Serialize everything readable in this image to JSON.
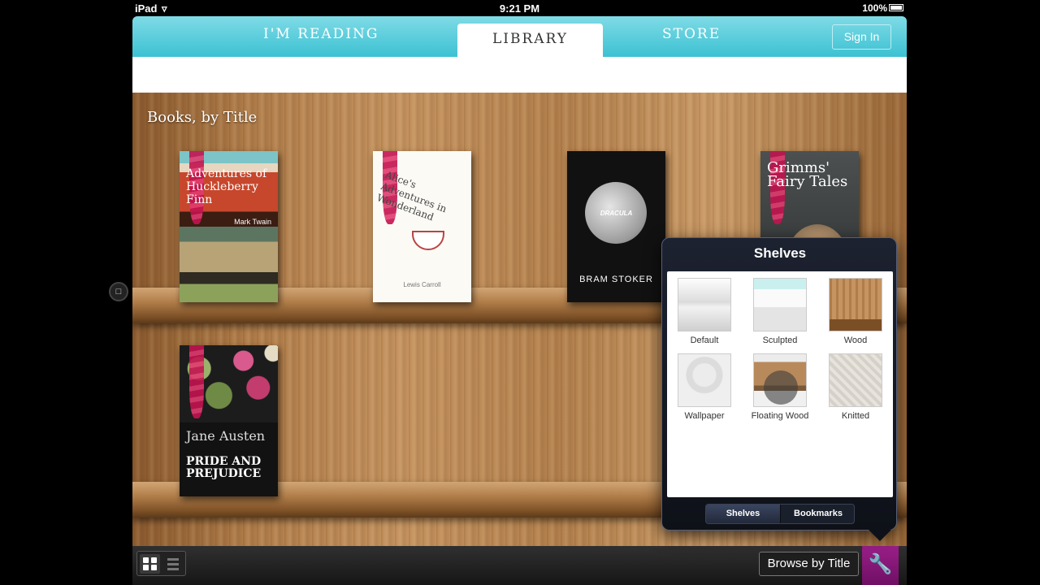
{
  "status": {
    "carrier": "iPad",
    "time": "9:21 PM",
    "battery": "100%"
  },
  "nav": {
    "tabs": [
      "I'M READING",
      "LIBRARY",
      "STORE"
    ],
    "active_tab": "LIBRARY",
    "signin_label": "Sign In"
  },
  "library": {
    "heading": "Books, by Title",
    "books": [
      {
        "title": "Adventures of Huckleberry Finn",
        "author": "Mark Twain"
      },
      {
        "title": "Alice's Adventures in Wonderland",
        "author": "Lewis Carroll"
      },
      {
        "title": "DRACULA",
        "author": "BRAM STOKER"
      },
      {
        "title": "Grimms' Fairy Tales",
        "author": ""
      },
      {
        "title": "PRIDE AND PREJUDICE",
        "author": "Jane Austen"
      }
    ]
  },
  "popover": {
    "title": "Shelves",
    "options": [
      "Default",
      "Sculpted",
      "Wood",
      "Wallpaper",
      "Floating Wood",
      "Knitted"
    ],
    "segments": [
      "Shelves",
      "Bookmarks"
    ],
    "active_segment": "Shelves"
  },
  "toolbar": {
    "browse_label": "Browse by Title"
  },
  "colors": {
    "nav_accent": "#3cc1d2",
    "wrench_button": "#8b1a7d"
  },
  "icons": {
    "wrench": "wrench-icon",
    "grid": "grid-view-icon",
    "list": "list-view-icon"
  }
}
